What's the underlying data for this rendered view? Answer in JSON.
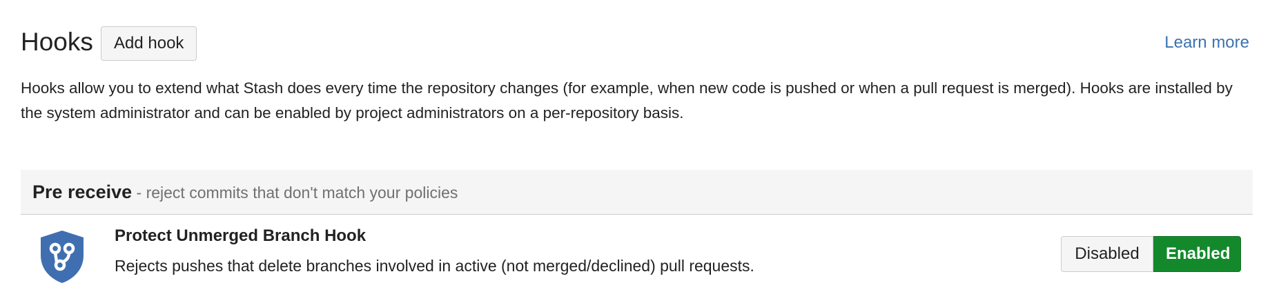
{
  "header": {
    "title": "Hooks",
    "add_hook_label": "Add hook",
    "learn_more_label": "Learn more"
  },
  "description": "Hooks allow you to extend what Stash does every time the repository changes (for example, when new code is pushed or when a pull request is merged). Hooks are installed by the system administrator and can be enabled by project administrators on a per-repository basis.",
  "section": {
    "title": "Pre receive",
    "subtitle": " - reject commits that don't match your policies"
  },
  "hooks": [
    {
      "name": "Protect Unmerged Branch Hook",
      "description": "Rejects pushes that delete branches involved in active (not merged/declined) pull requests.",
      "icon": "shield-branch-icon",
      "toggle": {
        "disabled_label": "Disabled",
        "enabled_label": "Enabled",
        "state": "Enabled"
      }
    }
  ],
  "colors": {
    "link": "#3b73af",
    "enabled": "#14892c",
    "icon": "#3f6fb0",
    "section_bg": "#f5f5f5"
  }
}
